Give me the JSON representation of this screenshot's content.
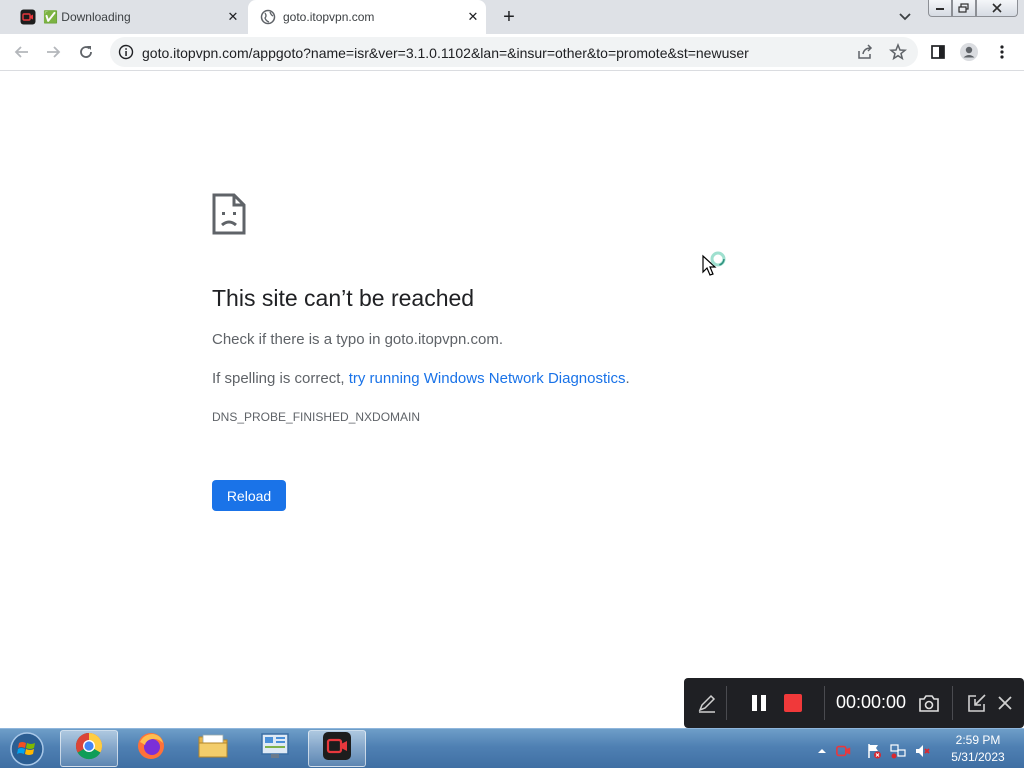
{
  "browser": {
    "tabs": [
      {
        "title": "✅ Downloading",
        "favicon": "itop-recorder-icon",
        "active": false
      },
      {
        "title": "goto.itopvpn.com",
        "favicon": "globe-icon",
        "active": true
      }
    ],
    "new_tab_label": "+",
    "address": "goto.itopvpn.com/appgoto?name=isr&ver=3.1.0.1102&lan=&insur=other&to=promote&st=newuser"
  },
  "error_page": {
    "heading": "This site can’t be reached",
    "line1": "Check if there is a typo in goto.itopvpn.com.",
    "line2_prefix": "If spelling is correct, ",
    "line2_link": "try running Windows Network Diagnostics",
    "line2_suffix": ".",
    "error_code": "DNS_PROBE_FINISHED_NXDOMAIN",
    "reload_label": "Reload"
  },
  "recorder": {
    "time": "00:00:00",
    "stop_color": "#f0393a"
  },
  "taskbar": {
    "apps": [
      "chrome-icon",
      "firefox-icon",
      "file-explorer-icon",
      "control-panel-icon",
      "itop-recorder-icon"
    ],
    "time": "2:59 PM",
    "date": "5/31/2023"
  },
  "colors": {
    "accent": "#1a73e8",
    "tabstrip": "#dee1e6"
  }
}
